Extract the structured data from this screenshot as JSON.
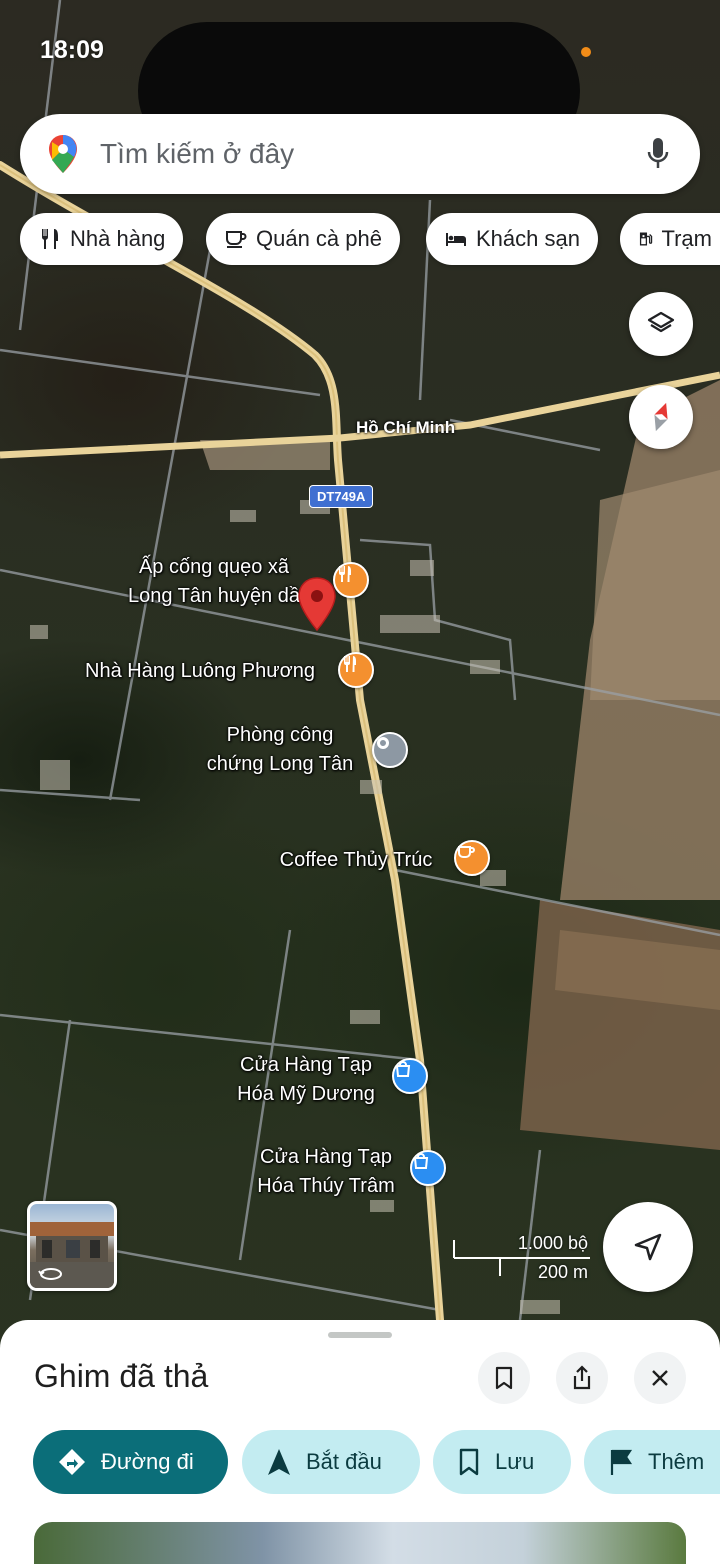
{
  "status": {
    "time": "18:09"
  },
  "search": {
    "placeholder": "Tìm kiếm ở đây"
  },
  "chips": [
    {
      "label": "Nhà hàng",
      "icon": "fork-knife-icon"
    },
    {
      "label": "Quán cà phê",
      "icon": "coffee-cup-icon"
    },
    {
      "label": "Khách sạn",
      "icon": "bed-icon"
    },
    {
      "label": "Trạm",
      "icon": "gas-pump-icon"
    }
  ],
  "map": {
    "roads": {
      "highway": "Hồ Chí Minh",
      "shield": "DT749A"
    },
    "pins": {
      "dropped": "Ấp cống quẹo xã\nLong Tân huyện dầ",
      "restaurant": "Nhà Hàng Luông Phương",
      "notary": "Phòng công\nchứng Long Tân",
      "coffee": "Coffee Thủy Trúc",
      "store1": "Cửa Hàng Tạp\nHóa Mỹ Dương",
      "store2": "Cửa Hàng Tạp\nHóa Thúy Trâm"
    },
    "scale": {
      "imperial": "1.000 bộ",
      "metric": "200 m"
    }
  },
  "sheet": {
    "title": "Ghim đã thả",
    "actions": {
      "directions": "Đường đi",
      "start": "Bắt đầu",
      "save": "Lưu",
      "more": "Thêm"
    }
  },
  "colors": {
    "accent": "#0b6e79",
    "accent_light": "#c3ecf1",
    "road": "#e9d39a",
    "pin": "#e53935",
    "poi_orange": "#f4902f",
    "poi_blue": "#2b8ef2"
  }
}
